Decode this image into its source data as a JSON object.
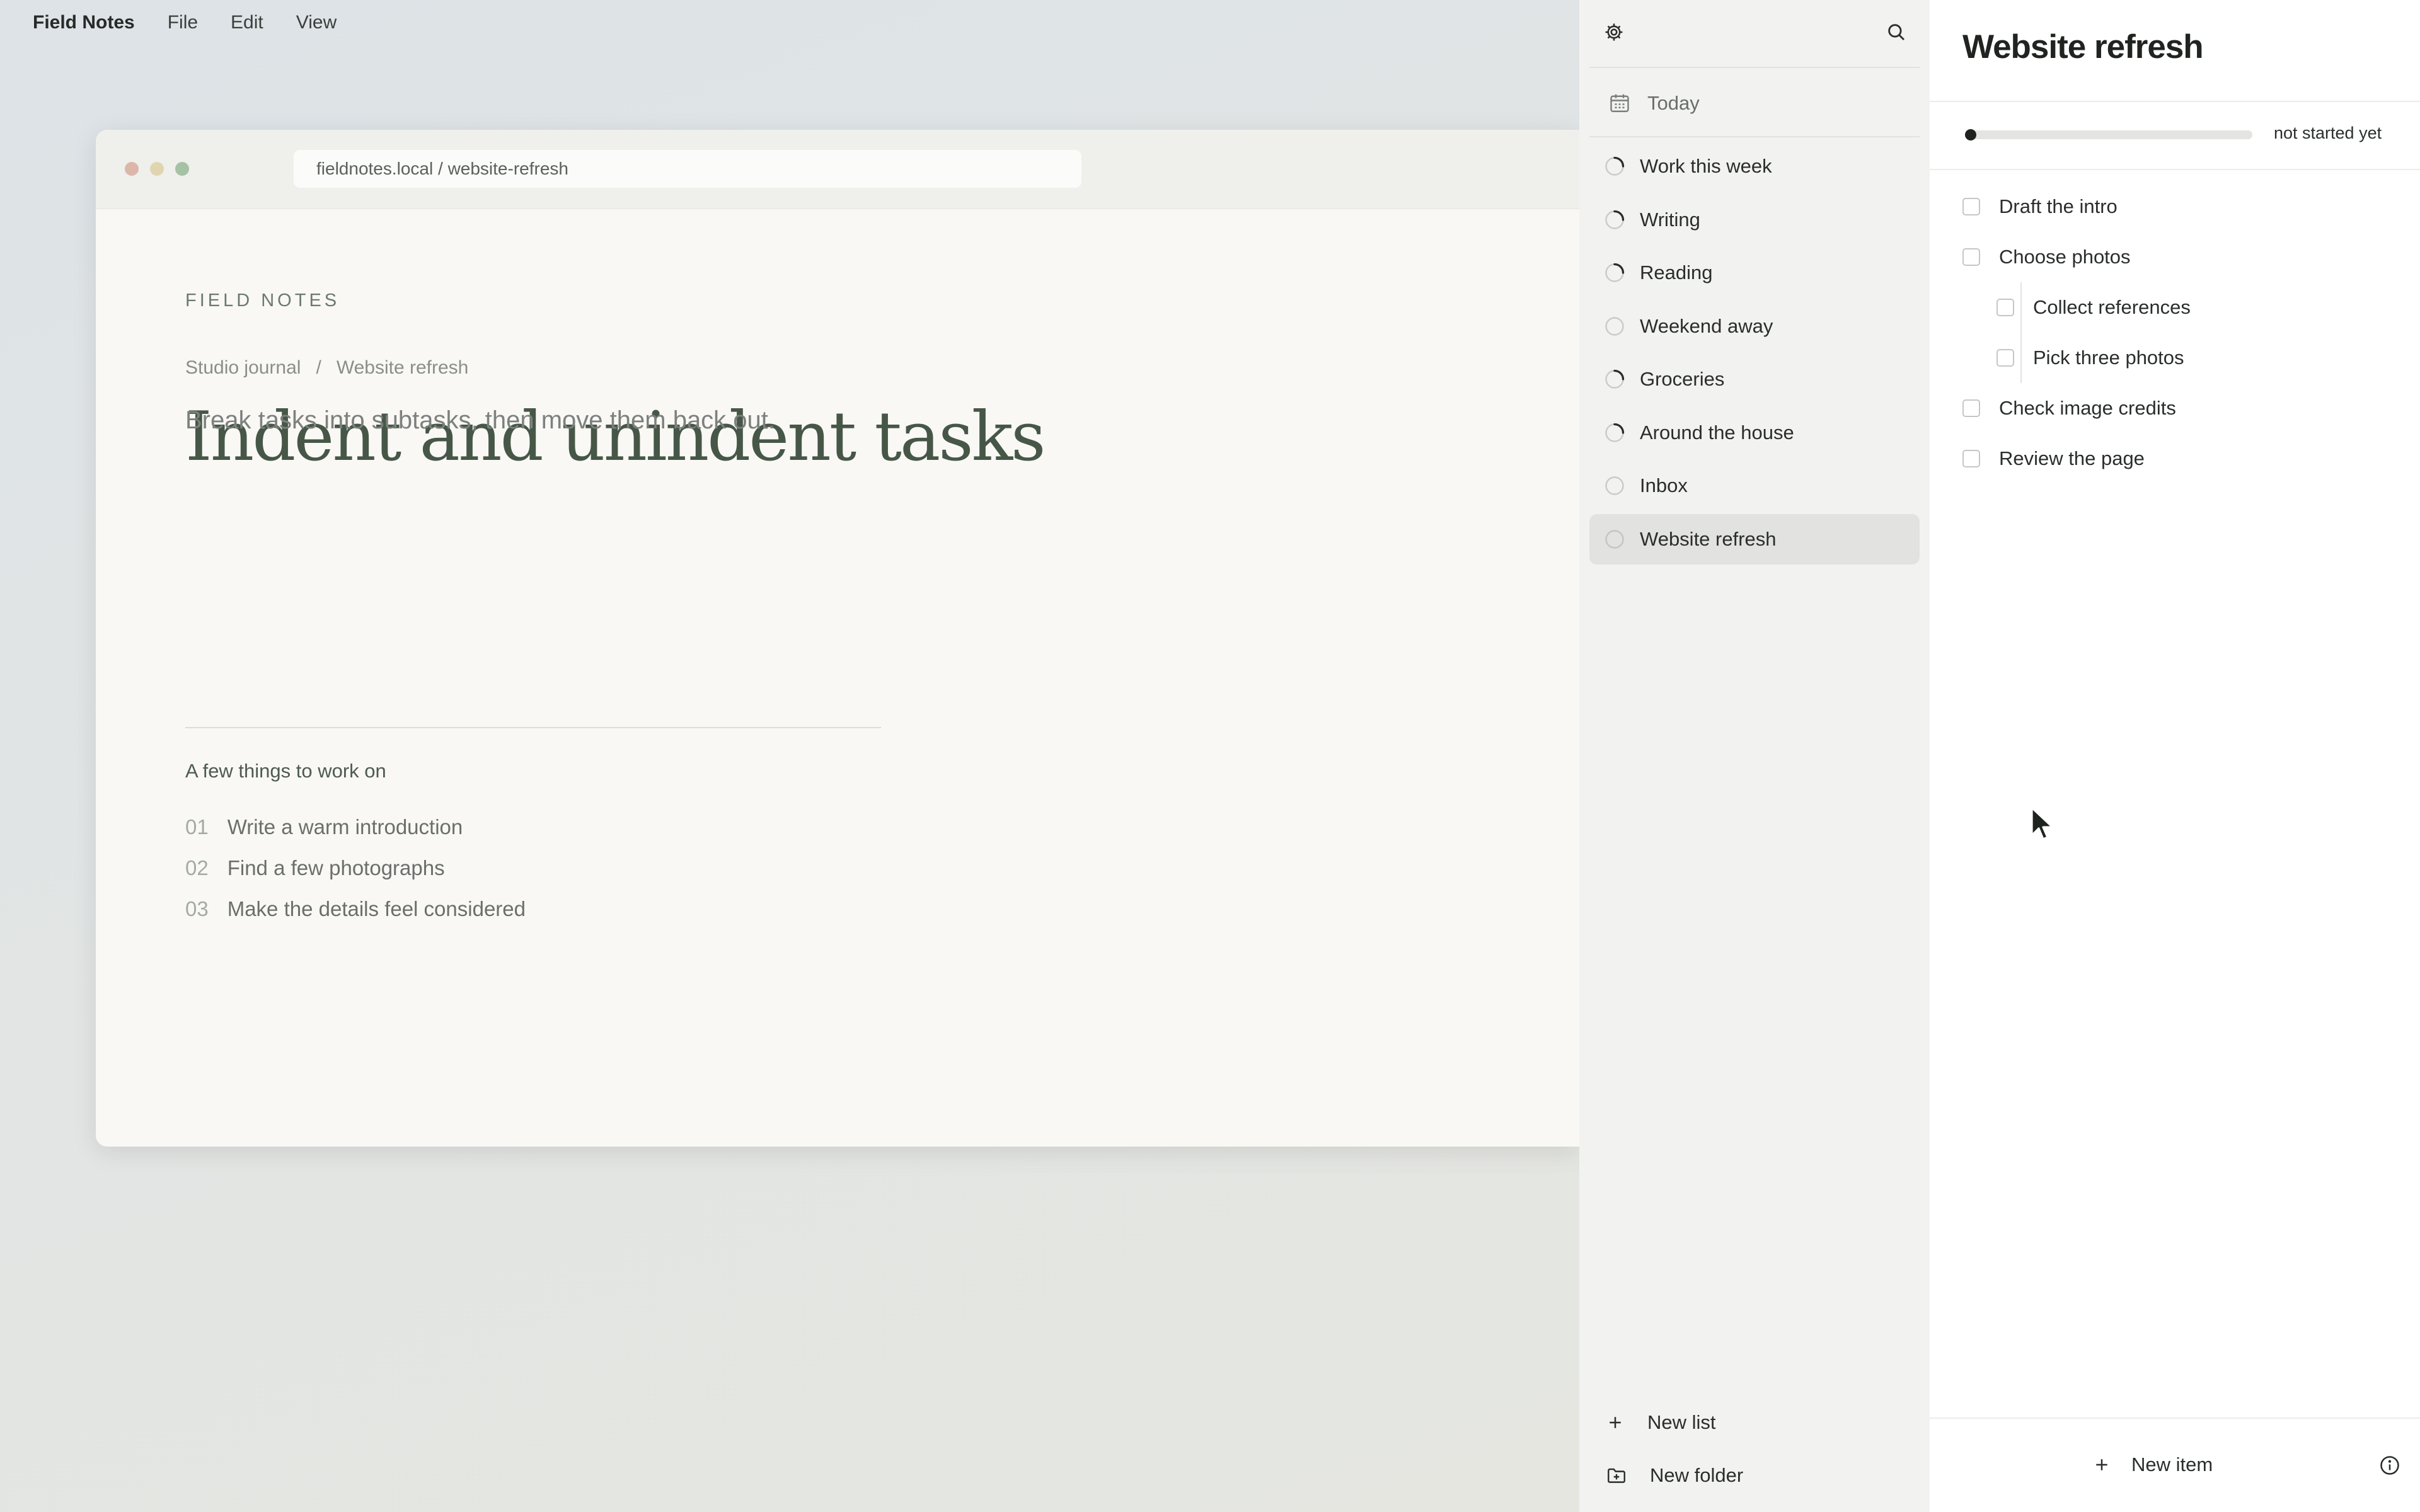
{
  "menubar": {
    "app_name": "Field Notes",
    "menus": [
      "File",
      "Edit",
      "View"
    ]
  },
  "browser": {
    "url": "fieldnotes.local / website-refresh",
    "page": {
      "eyebrow": "FIELD NOTES",
      "breadcrumb": [
        "Studio journal",
        "Website refresh"
      ],
      "breadcrumb_separator": "/",
      "title": "Indent and unindent tasks",
      "subtitle": "Break tasks into subtasks, then move them back out.",
      "section_title": "A few things to work on",
      "items": [
        {
          "num": "01",
          "text": "Write a warm introduction"
        },
        {
          "num": "02",
          "text": "Find a few photographs"
        },
        {
          "num": "03",
          "text": "Make the details feel considered"
        }
      ]
    }
  },
  "sidebar": {
    "today_label": "Today",
    "lists": [
      {
        "label": "Work this week",
        "progress": 0.25,
        "active": false
      },
      {
        "label": "Writing",
        "progress": 0.25,
        "active": false
      },
      {
        "label": "Reading",
        "progress": 0.25,
        "active": false
      },
      {
        "label": "Weekend away",
        "progress": 0,
        "active": false
      },
      {
        "label": "Groceries",
        "progress": 0.25,
        "active": false
      },
      {
        "label": "Around the house",
        "progress": 0.25,
        "active": false
      },
      {
        "label": "Inbox",
        "progress": 0,
        "active": false
      },
      {
        "label": "Website refresh",
        "progress": 0,
        "active": true
      }
    ],
    "new_list_label": "New list",
    "new_folder_label": "New folder"
  },
  "detail": {
    "title": "Website refresh",
    "progress": 0,
    "status": "not started yet",
    "tasks": [
      {
        "label": "Draft the intro",
        "level": 0,
        "checked": false
      },
      {
        "label": "Choose photos",
        "level": 0,
        "checked": false
      },
      {
        "label": "Collect references",
        "level": 1,
        "checked": false
      },
      {
        "label": "Pick three photos",
        "level": 1,
        "checked": false
      },
      {
        "label": "Check image credits",
        "level": 0,
        "checked": false
      },
      {
        "label": "Review the page",
        "level": 0,
        "checked": false
      }
    ],
    "new_item_label": "New item"
  },
  "colors": {
    "accent_title": "#465747",
    "sidebar_bg": "#f2f2f1",
    "active_row": "#e2e2e1",
    "progress_dark": "#1f2320"
  }
}
